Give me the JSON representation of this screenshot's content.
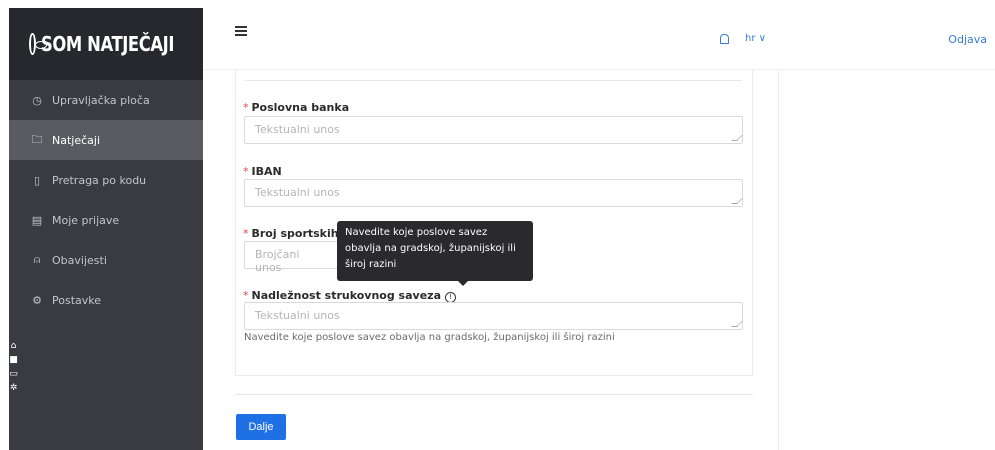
{
  "brand": {
    "name": "SOM NATJEČAJI"
  },
  "sidebar": {
    "items": [
      {
        "label": "Upravljačka ploča",
        "icon": "dashboard-icon",
        "glyph": "◷"
      },
      {
        "label": "Natječaji",
        "icon": "folder-icon",
        "glyph": "🗀",
        "active": true
      },
      {
        "label": "Pretraga po kodu",
        "icon": "document-icon",
        "glyph": "▯"
      },
      {
        "label": "Moje prijave",
        "icon": "file-icon",
        "glyph": "▤"
      },
      {
        "label": "Obavijesti",
        "icon": "bell-icon",
        "glyph": "♫"
      },
      {
        "label": "Postavke",
        "icon": "gear-icon",
        "glyph": "⚙"
      }
    ]
  },
  "header": {
    "language": "hr ∨",
    "logout": "Odjava"
  },
  "form": {
    "fields": [
      {
        "label": "Poslovna banka",
        "placeholder": "Tekstualni unos"
      },
      {
        "label": "IBAN",
        "placeholder": "Tekstualni unos"
      },
      {
        "label": "Broj sportskih u",
        "placeholder": "Brojčani unos"
      },
      {
        "label": "Nadležnost strukovnog saveza",
        "placeholder": "Tekstualni unos"
      }
    ],
    "help_text": "Navedite koje poslove savez obavlja na gradskoj, županijskoj ili široj razini",
    "tooltip": "Navedite koje poslove savez obavlja na gradskoj, županijskoj ili široj razini",
    "submit": "Dalje"
  },
  "colors": {
    "accent": "#1f6fe5",
    "sidebar": "#3a3b42",
    "required": "#e5484d"
  }
}
